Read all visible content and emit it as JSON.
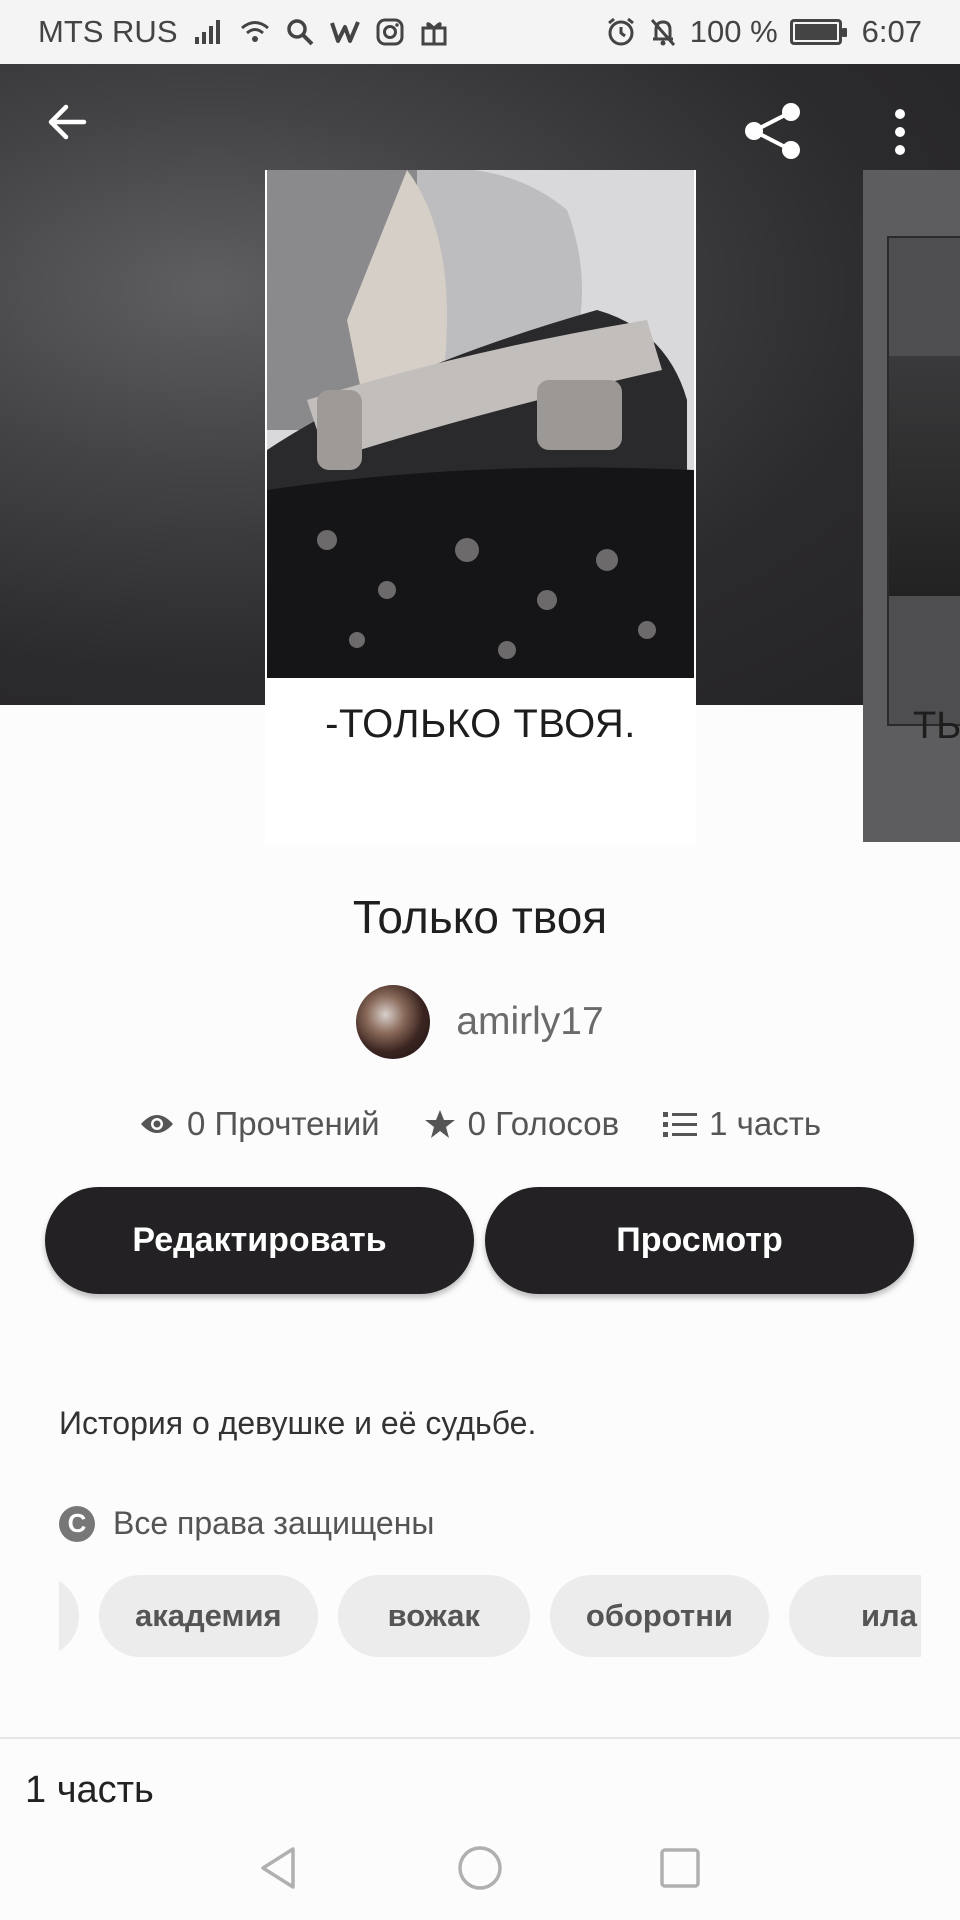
{
  "status_bar": {
    "carrier": "MTS RUS",
    "battery": "100 %",
    "time": "6:07",
    "icons": [
      "signal-icon",
      "wifi-icon",
      "search-icon",
      "wattpad-icon",
      "instagram-icon",
      "gift-icon",
      "alarm-icon",
      "bell-off-icon",
      "battery-icon"
    ]
  },
  "header": {
    "back_icon": "arrow-left-icon",
    "share_icon": "share-icon",
    "more_icon": "more-vertical-icon"
  },
  "cover": {
    "title_text": "-ТОЛЬКО ТВОЯ.",
    "next_cover_text": "ТЬ"
  },
  "story": {
    "title": "Только твоя",
    "author": "amirly17",
    "stats": {
      "reads": "0 Прочтений",
      "votes": "0 Голосов",
      "parts": "1 часть"
    },
    "description": "История о девушке и её судьбе.",
    "copyright": "Все права защищены",
    "tags": [
      "",
      "академия",
      "вожак",
      "оборотни",
      "ила"
    ]
  },
  "buttons": {
    "edit": "Редактировать",
    "view": "Просмотр"
  },
  "parts_section": {
    "label": "1 часть"
  },
  "colors": {
    "button_bg": "#232124",
    "header_bg": "#2b2a2c",
    "tag_bg": "#ececec"
  }
}
